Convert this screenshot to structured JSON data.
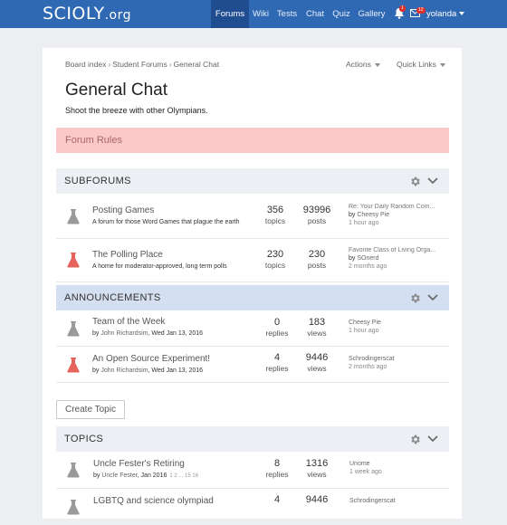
{
  "site": {
    "logo": "SCIOLY",
    "logo_tld": ".org"
  },
  "nav": {
    "items": [
      "Forums",
      "Wiki",
      "Tests",
      "Chat",
      "Quiz",
      "Gallery"
    ],
    "notif_badge": "1",
    "mail_badge": "12",
    "user": "yolanda"
  },
  "breadcrumb": [
    "Board index",
    "Student Forums",
    "General Chat"
  ],
  "tools": {
    "actions": "Actions",
    "quick_links": "Quick Links"
  },
  "page": {
    "title": "General Chat",
    "description": "Shoot the breeze with other Olympians."
  },
  "forum_rules": "Forum Rules",
  "subforums": {
    "heading": "SUBFORUMS",
    "rows": [
      {
        "title": "Posting Games",
        "desc": "A forum for those Word Games that plague the earth",
        "topics": "356",
        "topics_label": "topics",
        "posts": "93996",
        "posts_label": "posts",
        "last_title": "Re: Your Daily Random Com...",
        "by": "by",
        "last_user": "Cheesy Pie",
        "last_time": "1 hour ago",
        "icon_color": "#9a9a9a"
      },
      {
        "title": "The Polling Place",
        "desc": "A home for moderator-approved, long term polls",
        "topics": "230",
        "topics_label": "topics",
        "posts": "230",
        "posts_label": "posts",
        "last_title": "Favorite Class of Living Orga...",
        "by": "by",
        "last_user": "SOnerd",
        "last_time": "2 months ago",
        "icon_color": "#e6625d"
      }
    ]
  },
  "announcements": {
    "heading": "ANNOUNCEMENTS",
    "rows": [
      {
        "title": "Team of the Week",
        "by": "by",
        "author": "John Richardsim",
        "date": ", Wed Jan 13, 2016",
        "replies": "0",
        "replies_label": "replies",
        "views": "183",
        "views_label": "views",
        "last_user": "Cheesy Pie",
        "last_time": "1 hour ago",
        "icon_color": "#9a9a9a"
      },
      {
        "title": "An Open Source Experiment!",
        "by": "by",
        "author": "John Richardsim",
        "date": ", Wed Jan 13, 2016",
        "replies": "4",
        "replies_label": "replies",
        "views": "9446",
        "views_label": "views",
        "last_user": "Schrodingerscat",
        "last_time": "2 months ago",
        "icon_color": "#e6625d"
      }
    ]
  },
  "create_topic": "Create Topic",
  "topics": {
    "heading": "TOPICS",
    "rows": [
      {
        "title": "Uncle Fester's Retiring",
        "by": "by",
        "author": "Uncle Fester",
        "date": ", Jan 2016",
        "pages": "1  2  ...  15  16",
        "replies": "8",
        "replies_label": "replies",
        "views": "1316",
        "views_label": "views",
        "last_user": "Unome",
        "last_time": "1 week ago",
        "icon_color": "#9a9a9a"
      },
      {
        "title": "LGBTQ and science olympiad",
        "replies": "4",
        "views": "9446",
        "last_user": "Schrodingerscat",
        "icon_color": "#9a9a9a"
      }
    ]
  }
}
